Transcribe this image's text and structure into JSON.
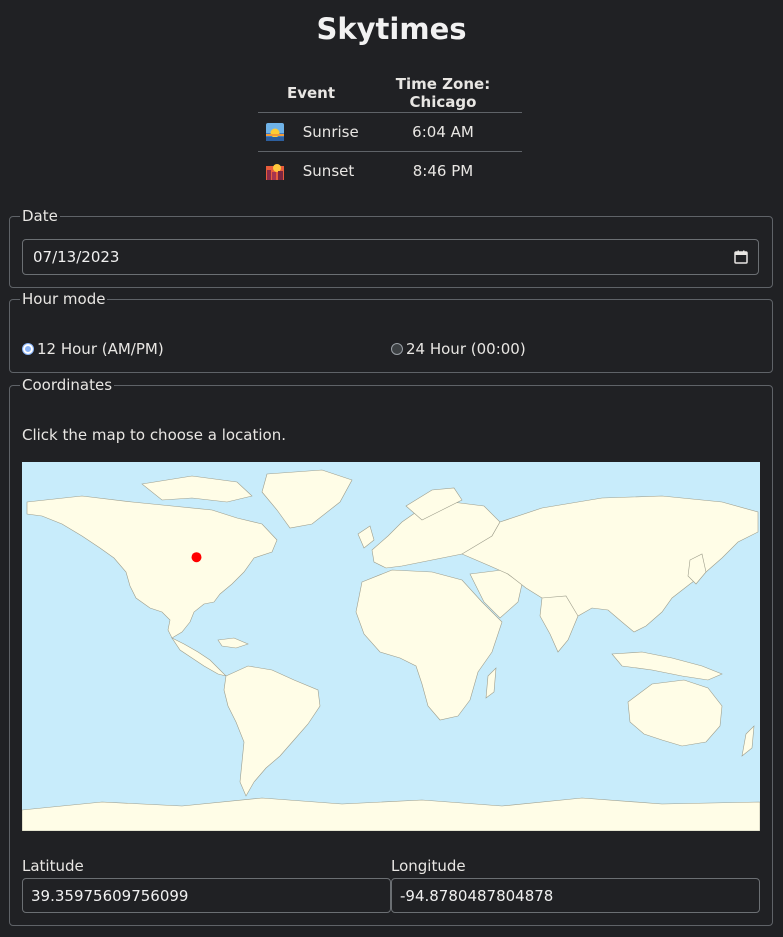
{
  "app": {
    "title": "Skytimes"
  },
  "times_table": {
    "headers": [
      "Event",
      "Time Zone: Chicago"
    ],
    "rows": [
      {
        "icon": "sunrise-icon",
        "event": "Sunrise",
        "time": "6:04 AM"
      },
      {
        "icon": "sunset-icon",
        "event": "Sunset",
        "time": "8:46 PM"
      }
    ]
  },
  "date": {
    "legend": "Date",
    "value": "07/13/2023",
    "icon": "calendar-icon"
  },
  "hour_mode": {
    "legend": "Hour mode",
    "options": [
      {
        "label": "12 Hour (AM/PM)",
        "selected": true
      },
      {
        "label": "24 Hour (00:00)",
        "selected": false
      }
    ]
  },
  "coordinates": {
    "legend": "Coordinates",
    "hint": "Click the map to choose a location.",
    "latitude_label": "Latitude",
    "latitude_value": "39.35975609756099",
    "longitude_label": "Longitude",
    "longitude_value": "-94.8780487804878",
    "marker_color": "#ff0000"
  },
  "colors": {
    "background": "#202124",
    "ocean": "#c8ecfb",
    "land": "#fffde7"
  }
}
